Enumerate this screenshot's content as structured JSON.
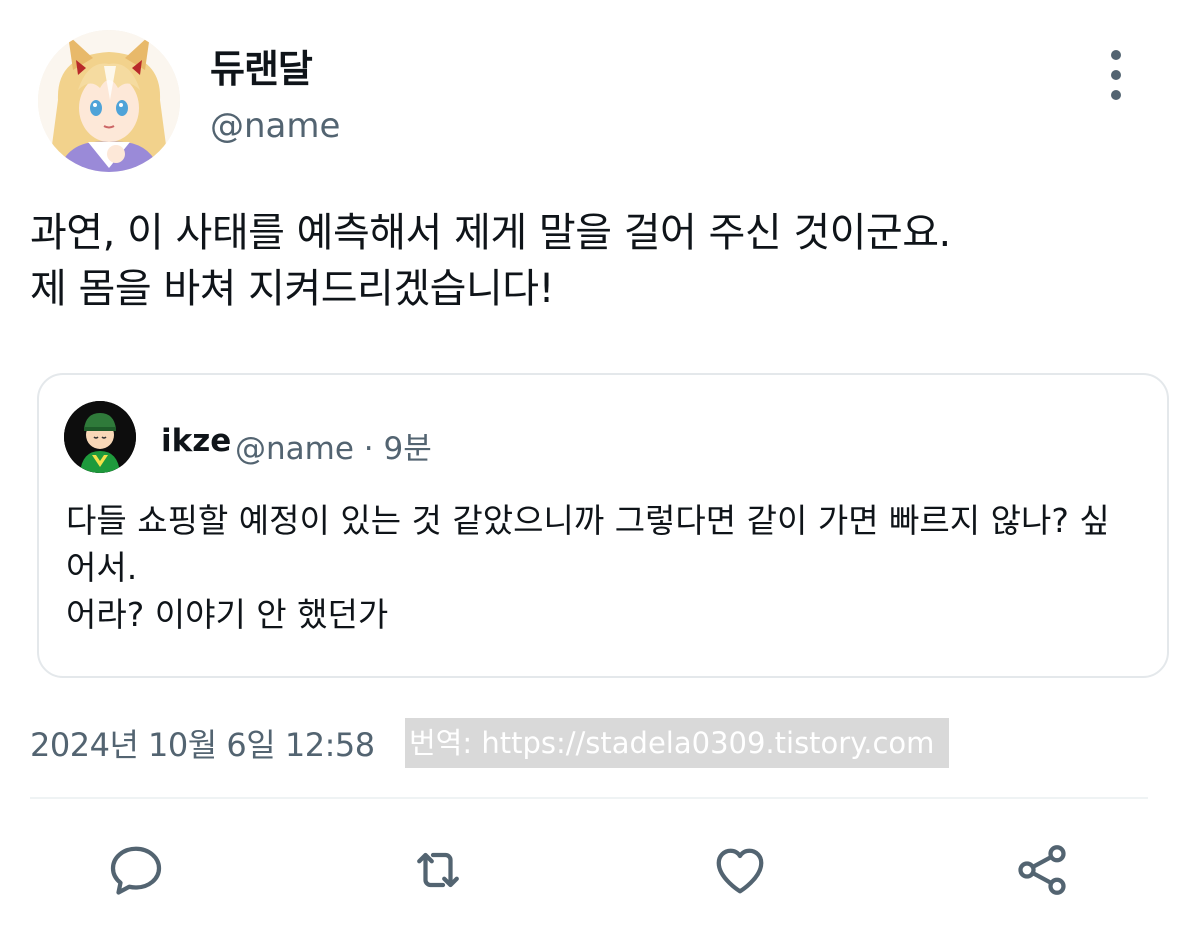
{
  "author": {
    "display_name": "듀랜달",
    "handle": "@name"
  },
  "tweet": {
    "text": "과연, 이 사태를 예측해서 제게 말을 걸어 주신 것이군요.\n제 몸을 바쳐 지켜드리겠습니다!"
  },
  "quote": {
    "display_name": "ikze",
    "meta": "@name · 9분",
    "text": "다들 쇼핑할 예정이 있는 것 같았으니까 그렇다면 같이 가면 빠르지 않나? 싶어서.\n어라? 이야기 안 했던가"
  },
  "footer": {
    "timestamp": "2024년 10월 6일  12:58",
    "watermark": "번역: https://stadela0309.tistory.com"
  },
  "icons": {
    "more": "more-vertical-icon",
    "reply": "reply-icon",
    "retweet": "retweet-icon",
    "like": "heart-icon",
    "share": "share-icon"
  },
  "colors": {
    "text_primary": "#0f1419",
    "text_secondary": "#536471",
    "border": "#e4e8eb",
    "watermark_bg": "#d9d9d9"
  }
}
